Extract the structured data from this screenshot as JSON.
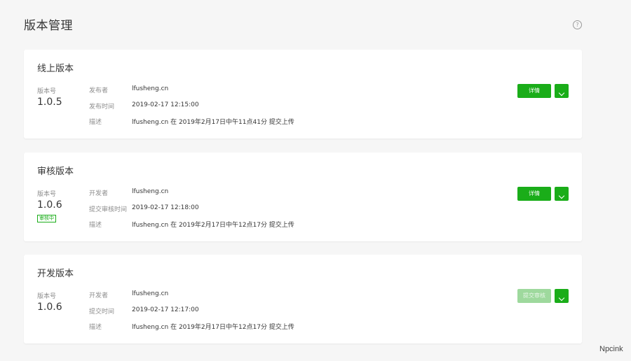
{
  "page": {
    "title": "版本管理",
    "help_icon": "?"
  },
  "cards": [
    {
      "title": "线上版本",
      "version_label": "版本号",
      "version": "1.0.5",
      "badge": "",
      "rows": [
        {
          "key": "发布者",
          "value": "lfusheng.cn"
        },
        {
          "key": "发布时间",
          "value": "2019-02-17 12:15:00"
        },
        {
          "key": "描述",
          "value": "lfusheng.cn 在 2019年2月17日中午11点41分 提交上传"
        }
      ],
      "button_label": "详情",
      "button_disabled": false
    },
    {
      "title": "审核版本",
      "version_label": "版本号",
      "version": "1.0.6",
      "badge": "审核中",
      "rows": [
        {
          "key": "开发者",
          "value": "lfusheng.cn"
        },
        {
          "key": "提交审核时间",
          "value": "2019-02-17 12:18:00"
        },
        {
          "key": "描述",
          "value": "lfusheng.cn 在 2019年2月17日中午12点17分 提交上传"
        }
      ],
      "button_label": "详情",
      "button_disabled": false
    },
    {
      "title": "开发版本",
      "version_label": "版本号",
      "version": "1.0.6",
      "badge": "",
      "rows": [
        {
          "key": "开发者",
          "value": "lfusheng.cn"
        },
        {
          "key": "提交时间",
          "value": "2019-02-17 12:17:00"
        },
        {
          "key": "描述",
          "value": "lfusheng.cn 在 2019年2月17日中午12点17分 提交上传"
        }
      ],
      "button_label": "提交审核",
      "button_disabled": true
    }
  ],
  "watermark": {
    "text": "Npcink"
  },
  "colors": {
    "accent": "#1aad19",
    "accent_disabled": "#9ed99d",
    "background": "#f6f6f6"
  }
}
